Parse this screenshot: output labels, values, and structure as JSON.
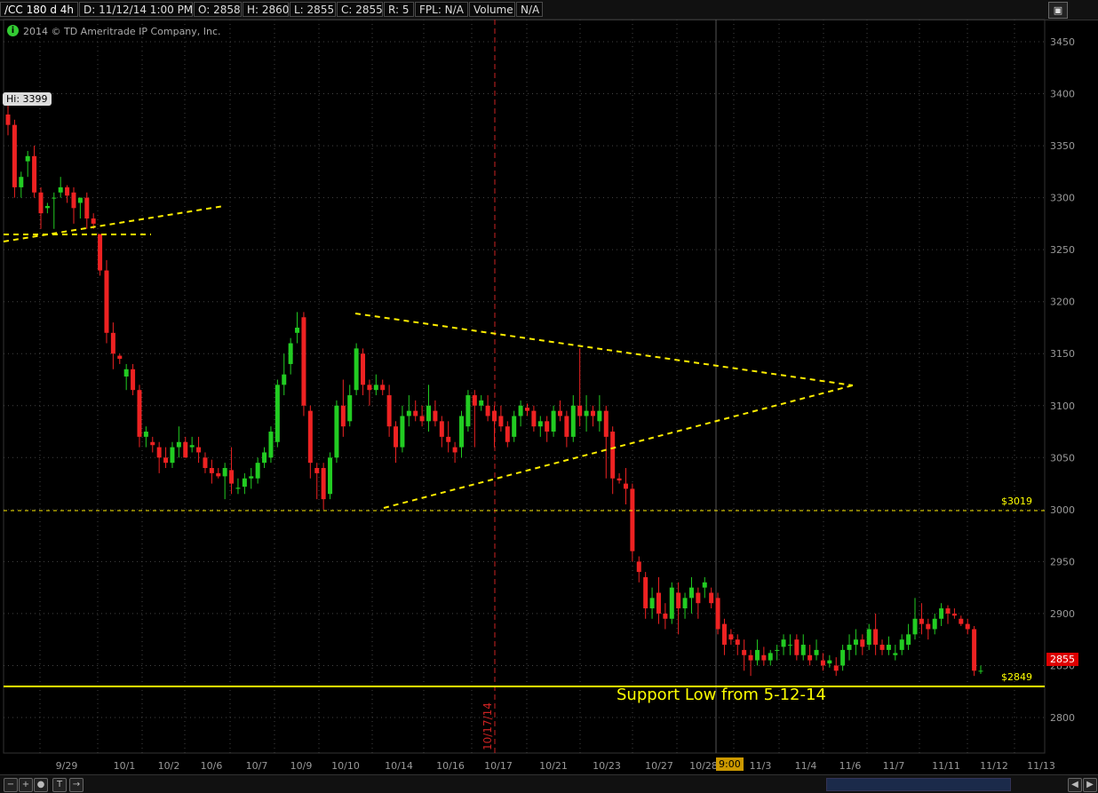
{
  "header": {
    "symbol": "/CC 180 d 4h",
    "date": "D: 11/12/14 1:00 PM",
    "open": "O: 2858",
    "high": "H: 2860",
    "low": "L: 2855",
    "close": "C: 2855",
    "range": "R: 5",
    "fpl": "FPL: N/A",
    "volume_label": "Volume",
    "volume_value": "N/A"
  },
  "copyright": "2014 © TD Ameritrade IP Company, Inc.",
  "hi_label": "Hi: 3399",
  "last_price": "2855",
  "support_label": "Support Low from 5-12-14",
  "level_3019": "$3019",
  "level_2849": "$2849",
  "vertical_marker": "10/17/14",
  "time_badge": "9:00",
  "colors": {
    "up": "#22cc22",
    "down": "#ee2222",
    "trend": "#ffee00",
    "grid": "#444444",
    "support": "#ffff00",
    "vmarker": "#cc2222"
  },
  "chart_data": {
    "type": "candlestick",
    "y_ticks": [
      2800,
      2850,
      2900,
      2950,
      3000,
      3050,
      3100,
      3150,
      3200,
      3250,
      3300,
      3350,
      3400,
      3450
    ],
    "y_tick_labels": [
      "2800",
      "2850",
      "2900",
      "2950",
      "3000",
      "3050",
      "3100",
      "3150",
      "3200",
      "3250",
      "3300",
      "3350",
      "3400",
      "3450"
    ],
    "ylim": [
      2770,
      3470
    ],
    "x_labels": [
      "9/29",
      "10/1",
      "10/2",
      "10/6",
      "10/7",
      "10/9",
      "10/10",
      "10/14",
      "10/16",
      "10/17",
      "10/21",
      "10/23",
      "10/27",
      "10/28",
      "11/3",
      "11/4",
      "11/6",
      "11/7",
      "11/11",
      "11/12",
      "11/13"
    ],
    "candles": [
      [
        3380,
        3399,
        3360,
        3370
      ],
      [
        3370,
        3375,
        3300,
        3310
      ],
      [
        3310,
        3325,
        3300,
        3320
      ],
      [
        3335,
        3345,
        3320,
        3340
      ],
      [
        3340,
        3350,
        3300,
        3305
      ],
      [
        3305,
        3310,
        3270,
        3285
      ],
      [
        3290,
        3295,
        3285,
        3292
      ],
      [
        3300,
        3305,
        3270,
        3300
      ],
      [
        3305,
        3320,
        3300,
        3310
      ],
      [
        3310,
        3312,
        3295,
        3302
      ],
      [
        3305,
        3310,
        3275,
        3290
      ],
      [
        3295,
        3300,
        3280,
        3300
      ],
      [
        3300,
        3305,
        3270,
        3280
      ],
      [
        3280,
        3285,
        3270,
        3275
      ],
      [
        3265,
        3265,
        3225,
        3230
      ],
      [
        3230,
        3240,
        3160,
        3170
      ],
      [
        3170,
        3180,
        3135,
        3150
      ],
      [
        3148,
        3150,
        3140,
        3145
      ],
      [
        3128,
        3140,
        3115,
        3135
      ],
      [
        3135,
        3140,
        3110,
        3115
      ],
      [
        3115,
        3120,
        3060,
        3070
      ],
      [
        3070,
        3080,
        3060,
        3075
      ],
      [
        3065,
        3070,
        3055,
        3062
      ],
      [
        3060,
        3065,
        3035,
        3050
      ],
      [
        3050,
        3060,
        3040,
        3045
      ],
      [
        3045,
        3065,
        3040,
        3060
      ],
      [
        3060,
        3080,
        3050,
        3065
      ],
      [
        3065,
        3070,
        3050,
        3050
      ],
      [
        3060,
        3070,
        3055,
        3062
      ],
      [
        3060,
        3070,
        3045,
        3055
      ],
      [
        3050,
        3055,
        3035,
        3040
      ],
      [
        3040,
        3048,
        3025,
        3035
      ],
      [
        3035,
        3040,
        3030,
        3032
      ],
      [
        3032,
        3045,
        3010,
        3040
      ],
      [
        3038,
        3060,
        3015,
        3025
      ],
      [
        3020,
        3030,
        3015,
        3021
      ],
      [
        3022,
        3035,
        3015,
        3030
      ],
      [
        3030,
        3040,
        3020,
        3032
      ],
      [
        3030,
        3050,
        3025,
        3045
      ],
      [
        3045,
        3060,
        3040,
        3055
      ],
      [
        3050,
        3080,
        3045,
        3075
      ],
      [
        3065,
        3125,
        3060,
        3120
      ],
      [
        3120,
        3150,
        3110,
        3130
      ],
      [
        3140,
        3165,
        3130,
        3160
      ],
      [
        3170,
        3190,
        3160,
        3175
      ],
      [
        3185,
        3190,
        3090,
        3100
      ],
      [
        3095,
        3100,
        3030,
        3045
      ],
      [
        3040,
        3045,
        3010,
        3035
      ],
      [
        3040,
        3045,
        3000,
        3010
      ],
      [
        3015,
        3055,
        3010,
        3050
      ],
      [
        3050,
        3105,
        3045,
        3100
      ],
      [
        3100,
        3125,
        3070,
        3080
      ],
      [
        3085,
        3120,
        3080,
        3110
      ],
      [
        3115,
        3160,
        3110,
        3155
      ],
      [
        3150,
        3155,
        3110,
        3120
      ],
      [
        3120,
        3125,
        3100,
        3115
      ],
      [
        3115,
        3130,
        3110,
        3120
      ],
      [
        3120,
        3125,
        3110,
        3115
      ],
      [
        3110,
        3120,
        3070,
        3080
      ],
      [
        3080,
        3085,
        3045,
        3060
      ],
      [
        3060,
        3100,
        3055,
        3090
      ],
      [
        3090,
        3110,
        3080,
        3095
      ],
      [
        3095,
        3105,
        3085,
        3090
      ],
      [
        3090,
        3100,
        3080,
        3085
      ],
      [
        3085,
        3120,
        3075,
        3100
      ],
      [
        3095,
        3105,
        3080,
        3085
      ],
      [
        3085,
        3090,
        3060,
        3070
      ],
      [
        3070,
        3085,
        3055,
        3065
      ],
      [
        3060,
        3065,
        3045,
        3055
      ],
      [
        3060,
        3095,
        3050,
        3090
      ],
      [
        3080,
        3115,
        3075,
        3110
      ],
      [
        3110,
        3115,
        3060,
        3100
      ],
      [
        3100,
        3110,
        3095,
        3105
      ],
      [
        3100,
        3110,
        3085,
        3090
      ],
      [
        3095,
        3100,
        3060,
        3085
      ],
      [
        3090,
        3100,
        3075,
        3080
      ],
      [
        3080,
        3085,
        3060,
        3065
      ],
      [
        3070,
        3095,
        3065,
        3090
      ],
      [
        3090,
        3105,
        3080,
        3100
      ],
      [
        3098,
        3102,
        3090,
        3095
      ],
      [
        3095,
        3100,
        3075,
        3080
      ],
      [
        3080,
        3090,
        3070,
        3085
      ],
      [
        3085,
        3090,
        3065,
        3075
      ],
      [
        3075,
        3100,
        3070,
        3095
      ],
      [
        3095,
        3105,
        3085,
        3090
      ],
      [
        3090,
        3095,
        3060,
        3070
      ],
      [
        3070,
        3110,
        3065,
        3100
      ],
      [
        3100,
        3155,
        3080,
        3090
      ],
      [
        3090,
        3110,
        3075,
        3095
      ],
      [
        3095,
        3100,
        3080,
        3090
      ],
      [
        3085,
        3110,
        3075,
        3095
      ],
      [
        3095,
        3100,
        3030,
        3070
      ],
      [
        3075,
        3080,
        3015,
        3030
      ],
      [
        3030,
        3035,
        3025,
        3028
      ],
      [
        3025,
        3040,
        3005,
        3020
      ],
      [
        3020,
        3025,
        2950,
        2960
      ],
      [
        2950,
        2955,
        2930,
        2940
      ],
      [
        2935,
        2940,
        2895,
        2905
      ],
      [
        2905,
        2925,
        2895,
        2915
      ],
      [
        2920,
        2935,
        2890,
        2900
      ],
      [
        2900,
        2910,
        2885,
        2895
      ],
      [
        2895,
        2930,
        2890,
        2925
      ],
      [
        2920,
        2930,
        2880,
        2905
      ],
      [
        2905,
        2920,
        2895,
        2915
      ],
      [
        2915,
        2935,
        2900,
        2925
      ],
      [
        2920,
        2925,
        2895,
        2910
      ],
      [
        2925,
        2935,
        2915,
        2930
      ],
      [
        2920,
        2925,
        2905,
        2910
      ],
      [
        2915,
        2920,
        2880,
        2885
      ],
      [
        2890,
        2895,
        2860,
        2870
      ],
      [
        2880,
        2885,
        2870,
        2875
      ],
      [
        2875,
        2880,
        2860,
        2870
      ],
      [
        2865,
        2875,
        2845,
        2860
      ],
      [
        2860,
        2865,
        2840,
        2855
      ],
      [
        2855,
        2875,
        2850,
        2865
      ],
      [
        2860,
        2868,
        2850,
        2855
      ],
      [
        2855,
        2865,
        2850,
        2862
      ],
      [
        2865,
        2870,
        2855,
        2865
      ],
      [
        2868,
        2880,
        2860,
        2875
      ],
      [
        2870,
        2880,
        2860,
        2870
      ],
      [
        2875,
        2880,
        2855,
        2860
      ],
      [
        2860,
        2880,
        2855,
        2870
      ],
      [
        2860,
        2870,
        2850,
        2855
      ],
      [
        2860,
        2875,
        2855,
        2865
      ],
      [
        2855,
        2862,
        2845,
        2850
      ],
      [
        2852,
        2860,
        2848,
        2855
      ],
      [
        2850,
        2858,
        2840,
        2845
      ],
      [
        2850,
        2870,
        2845,
        2865
      ],
      [
        2865,
        2880,
        2855,
        2870
      ],
      [
        2870,
        2885,
        2860,
        2875
      ],
      [
        2875,
        2880,
        2860,
        2868
      ],
      [
        2870,
        2890,
        2865,
        2885
      ],
      [
        2885,
        2900,
        2860,
        2870
      ],
      [
        2870,
        2875,
        2860,
        2865
      ],
      [
        2865,
        2878,
        2860,
        2870
      ],
      [
        2860,
        2870,
        2855,
        2862
      ],
      [
        2865,
        2880,
        2860,
        2875
      ],
      [
        2870,
        2890,
        2865,
        2880
      ],
      [
        2880,
        2915,
        2875,
        2895
      ],
      [
        2895,
        2910,
        2880,
        2890
      ],
      [
        2890,
        2895,
        2875,
        2885
      ],
      [
        2885,
        2900,
        2880,
        2895
      ],
      [
        2895,
        2910,
        2888,
        2905
      ],
      [
        2905,
        2908,
        2890,
        2900
      ],
      [
        2900,
        2905,
        2895,
        2898
      ],
      [
        2895,
        2898,
        2888,
        2890
      ],
      [
        2890,
        2895,
        2880,
        2885
      ],
      [
        2885,
        2888,
        2840,
        2845
      ],
      [
        2845,
        2850,
        2842,
        2845
      ]
    ]
  }
}
